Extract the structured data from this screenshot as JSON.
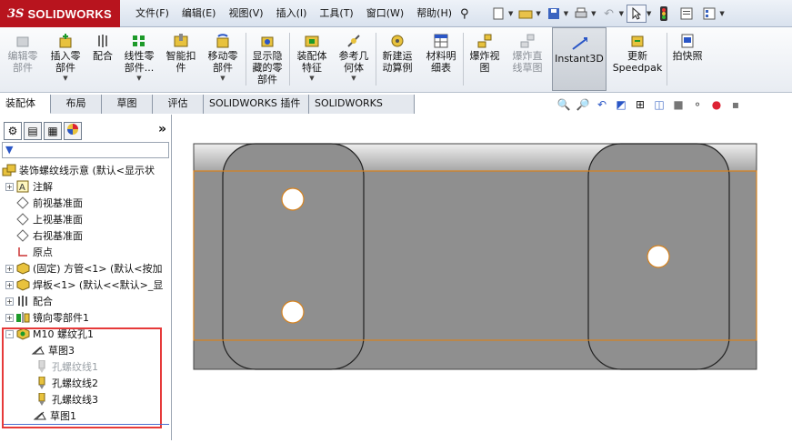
{
  "app": {
    "logo_mark": "3S",
    "logo_text": "SOLIDWORKS"
  },
  "menu": [
    "文件(F)",
    "编辑(E)",
    "视图(V)",
    "插入(I)",
    "工具(T)",
    "窗口(W)",
    "帮助(H)"
  ],
  "ribbon": {
    "commands": [
      {
        "label": "编辑零\n部件",
        "icon": "edit-component-icon",
        "disabled": true
      },
      {
        "label": "插入零\n部件",
        "icon": "insert-component-icon"
      },
      {
        "label": "配合",
        "icon": "mate-icon"
      },
      {
        "label": "线性零\n部件...",
        "icon": "linear-pattern-icon"
      },
      {
        "label": "智能扣\n件",
        "icon": "smart-fastener-icon"
      },
      {
        "label": "移动零\n部件",
        "icon": "move-component-icon"
      },
      {
        "label": "显示隐\n藏的零\n部件",
        "icon": "show-hidden-icon"
      },
      {
        "label": "装配体\n特征",
        "icon": "assembly-feature-icon"
      },
      {
        "label": "参考几\n何体",
        "icon": "reference-geometry-icon"
      },
      {
        "label": "新建运\n动算例",
        "icon": "motion-study-icon"
      },
      {
        "label": "材料明\n细表",
        "icon": "bom-icon"
      },
      {
        "label": "爆炸视\n图",
        "icon": "exploded-view-icon"
      },
      {
        "label": "爆炸直\n线草图",
        "icon": "explode-line-icon",
        "disabled": true
      },
      {
        "label": "Instant3D",
        "icon": "instant3d-icon",
        "active": true
      },
      {
        "label": "更新\nSpeedpak",
        "icon": "speedpak-icon"
      },
      {
        "label": "拍快照",
        "icon": "snapshot-icon"
      }
    ]
  },
  "tabs": [
    "装配体",
    "布局",
    "草图",
    "评估",
    "SOLIDWORKS 插件",
    "SOLIDWORKS MBD"
  ],
  "panel": {
    "more": "»",
    "filter": "▼"
  },
  "tree": [
    {
      "label": "装饰螺纹线示意 (默认<显示状",
      "icon": "assembly-icon",
      "expander": ""
    },
    {
      "label": "注解",
      "icon": "annotation-icon",
      "expander": "+"
    },
    {
      "label": "前视基准面",
      "icon": "plane-icon",
      "expander": ""
    },
    {
      "label": "上视基准面",
      "icon": "plane-icon",
      "expander": ""
    },
    {
      "label": "右视基准面",
      "icon": "plane-icon",
      "expander": ""
    },
    {
      "label": "原点",
      "icon": "origin-icon",
      "expander": ""
    },
    {
      "label": "(固定) 方管<1> (默认<按加",
      "icon": "part-icon",
      "expander": "+"
    },
    {
      "label": "焊板<1> (默认<<默认>_显",
      "icon": "part-icon",
      "expander": "+"
    },
    {
      "label": "配合",
      "icon": "mates-icon",
      "expander": "+"
    },
    {
      "label": "镜向零部件1",
      "icon": "mirror-icon",
      "expander": "+"
    },
    {
      "label": "M10 螺纹孔1",
      "icon": "hole-feature-icon",
      "expander": "-"
    },
    {
      "label": "草图3",
      "icon": "sketch-icon",
      "expander": ""
    },
    {
      "label": "孔螺纹线1",
      "icon": "thread-icon",
      "expander": "",
      "gray": true
    },
    {
      "label": "孔螺纹线2",
      "icon": "thread-icon",
      "expander": ""
    },
    {
      "label": "孔螺纹线3",
      "icon": "thread-icon",
      "expander": ""
    },
    {
      "label": "草图1",
      "icon": "sketch-icon",
      "expander": ""
    }
  ],
  "colors": {
    "accent": "#b8141e",
    "highlight_box": "#e63a3a",
    "edge_orange": "#d6821e",
    "body_gray": "#8f8f8f"
  }
}
